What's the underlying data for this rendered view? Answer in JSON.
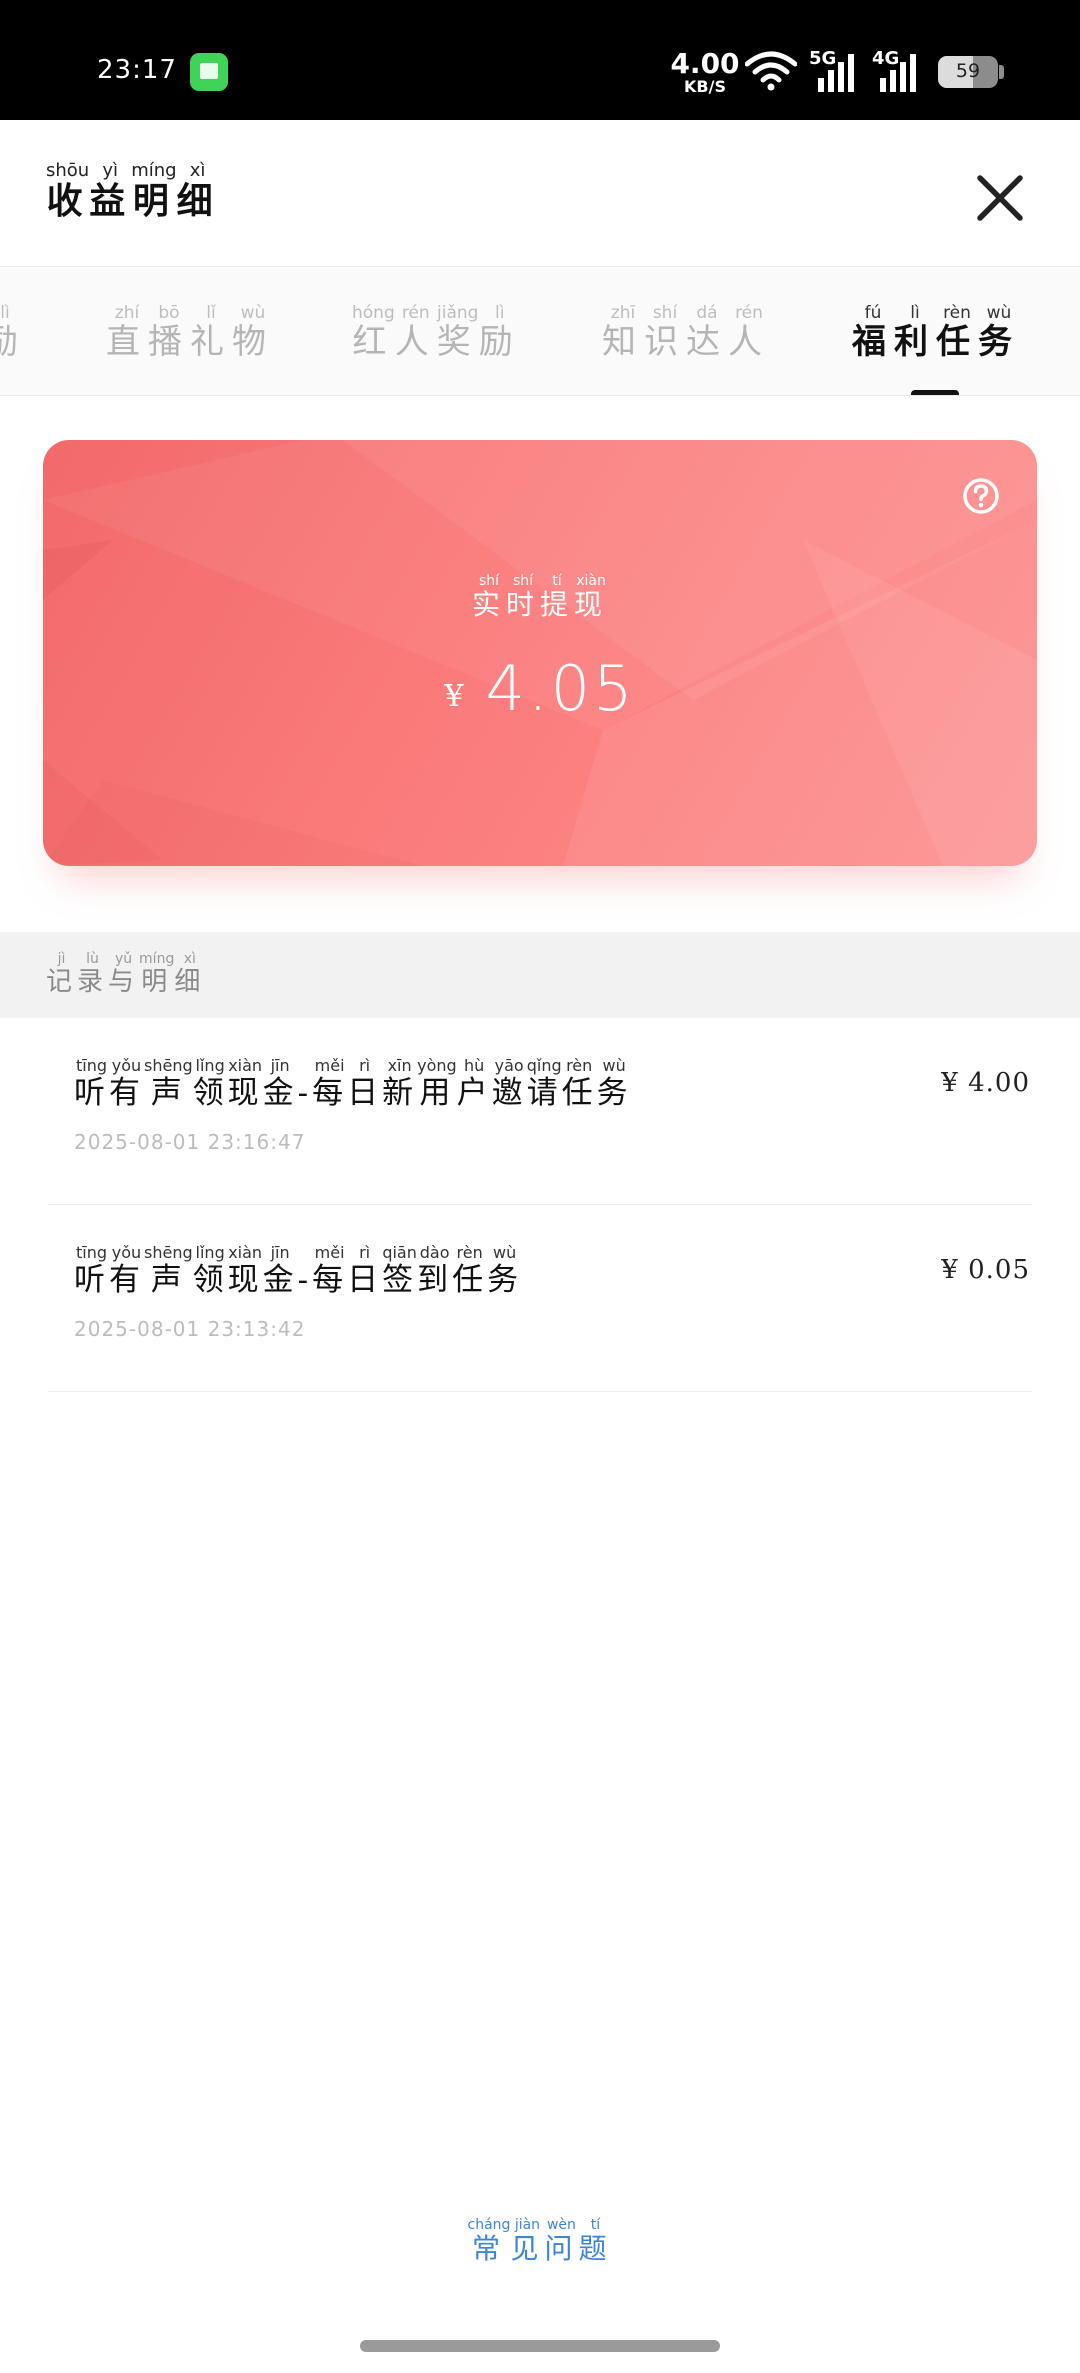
{
  "status_bar": {
    "time": "23:17",
    "net_speed_value": "4.00",
    "net_speed_unit": "KB/S",
    "signal_1_label": "5G",
    "signal_2_label": "4G",
    "battery_level": "59",
    "app_icon": "chat-app-icon"
  },
  "header": {
    "title": [
      {
        "char": "收",
        "py": "shōu"
      },
      {
        "char": "益",
        "py": "yì"
      },
      {
        "char": "明",
        "py": "míng"
      },
      {
        "char": "细",
        "py": "xì"
      }
    ],
    "close_icon": "close-icon"
  },
  "tabs": [
    {
      "id": "partial",
      "label": [
        {
          "char": "励",
          "py": "lì"
        }
      ]
    },
    {
      "id": "live-gift",
      "label": [
        {
          "char": "直",
          "py": "zhí"
        },
        {
          "char": "播",
          "py": "bō"
        },
        {
          "char": "礼",
          "py": "lǐ"
        },
        {
          "char": "物",
          "py": "wù"
        }
      ]
    },
    {
      "id": "influencer-reward",
      "label": [
        {
          "char": "红",
          "py": "hóng"
        },
        {
          "char": "人",
          "py": "rén"
        },
        {
          "char": "奖",
          "py": "jiǎng"
        },
        {
          "char": "励",
          "py": "lì"
        }
      ]
    },
    {
      "id": "knowledge-expert",
      "label": [
        {
          "char": "知",
          "py": "zhī"
        },
        {
          "char": "识",
          "py": "shí"
        },
        {
          "char": "达",
          "py": "dá"
        },
        {
          "char": "人",
          "py": "rén"
        }
      ]
    },
    {
      "id": "welfare-task",
      "active": true,
      "label": [
        {
          "char": "福",
          "py": "fú"
        },
        {
          "char": "利",
          "py": "lì"
        },
        {
          "char": "任",
          "py": "rèn"
        },
        {
          "char": "务",
          "py": "wù"
        }
      ]
    }
  ],
  "balance_card": {
    "label": [
      {
        "char": "实",
        "py": "shí"
      },
      {
        "char": "时",
        "py": "shí"
      },
      {
        "char": "提",
        "py": "tí"
      },
      {
        "char": "现",
        "py": "xiàn"
      }
    ],
    "currency": "¥",
    "amount": "4.05",
    "help_icon": "question-circle-icon"
  },
  "section": {
    "title": [
      {
        "char": "记",
        "py": "jì"
      },
      {
        "char": "录",
        "py": "lù"
      },
      {
        "char": "与",
        "py": "yǔ"
      },
      {
        "char": "明",
        "py": "míng"
      },
      {
        "char": "细",
        "py": "xì"
      }
    ]
  },
  "records": [
    {
      "title": [
        {
          "char": "听",
          "py": "tīng"
        },
        {
          "char": "有",
          "py": "yǒu"
        },
        {
          "char": "声",
          "py": "shēng"
        },
        {
          "char": "领",
          "py": "lǐng"
        },
        {
          "char": "现",
          "py": "xiàn"
        },
        {
          "char": "金",
          "py": "jīn"
        },
        {
          "char": "-",
          "py": ""
        },
        {
          "char": "每",
          "py": "měi"
        },
        {
          "char": "日",
          "py": "rì"
        },
        {
          "char": "新",
          "py": "xīn"
        },
        {
          "char": "用",
          "py": "yòng"
        },
        {
          "char": "户",
          "py": "hù"
        },
        {
          "char": "邀",
          "py": "yāo"
        },
        {
          "char": "请",
          "py": "qǐng"
        },
        {
          "char": "任",
          "py": "rèn"
        },
        {
          "char": "务",
          "py": "wù"
        }
      ],
      "time": "2025-08-01 23:16:47",
      "amount": "¥ 4.00"
    },
    {
      "title": [
        {
          "char": "听",
          "py": "tīng"
        },
        {
          "char": "有",
          "py": "yǒu"
        },
        {
          "char": "声",
          "py": "shēng"
        },
        {
          "char": "领",
          "py": "lǐng"
        },
        {
          "char": "现",
          "py": "xiàn"
        },
        {
          "char": "金",
          "py": "jīn"
        },
        {
          "char": "-",
          "py": ""
        },
        {
          "char": "每",
          "py": "měi"
        },
        {
          "char": "日",
          "py": "rì"
        },
        {
          "char": "签",
          "py": "qiān"
        },
        {
          "char": "到",
          "py": "dào"
        },
        {
          "char": "任",
          "py": "rèn"
        },
        {
          "char": "务",
          "py": "wù"
        }
      ],
      "time": "2025-08-01 23:13:42",
      "amount": "¥ 0.05"
    }
  ],
  "faq": {
    "label": [
      {
        "char": "常",
        "py": "cháng"
      },
      {
        "char": "见",
        "py": "jiàn"
      },
      {
        "char": "问",
        "py": "wèn"
      },
      {
        "char": "题",
        "py": "tí"
      }
    ]
  },
  "colors": {
    "card_start": "#f26a6a",
    "card_end": "#fd9090",
    "link": "#3d85d8",
    "active_tab": "#111111"
  }
}
